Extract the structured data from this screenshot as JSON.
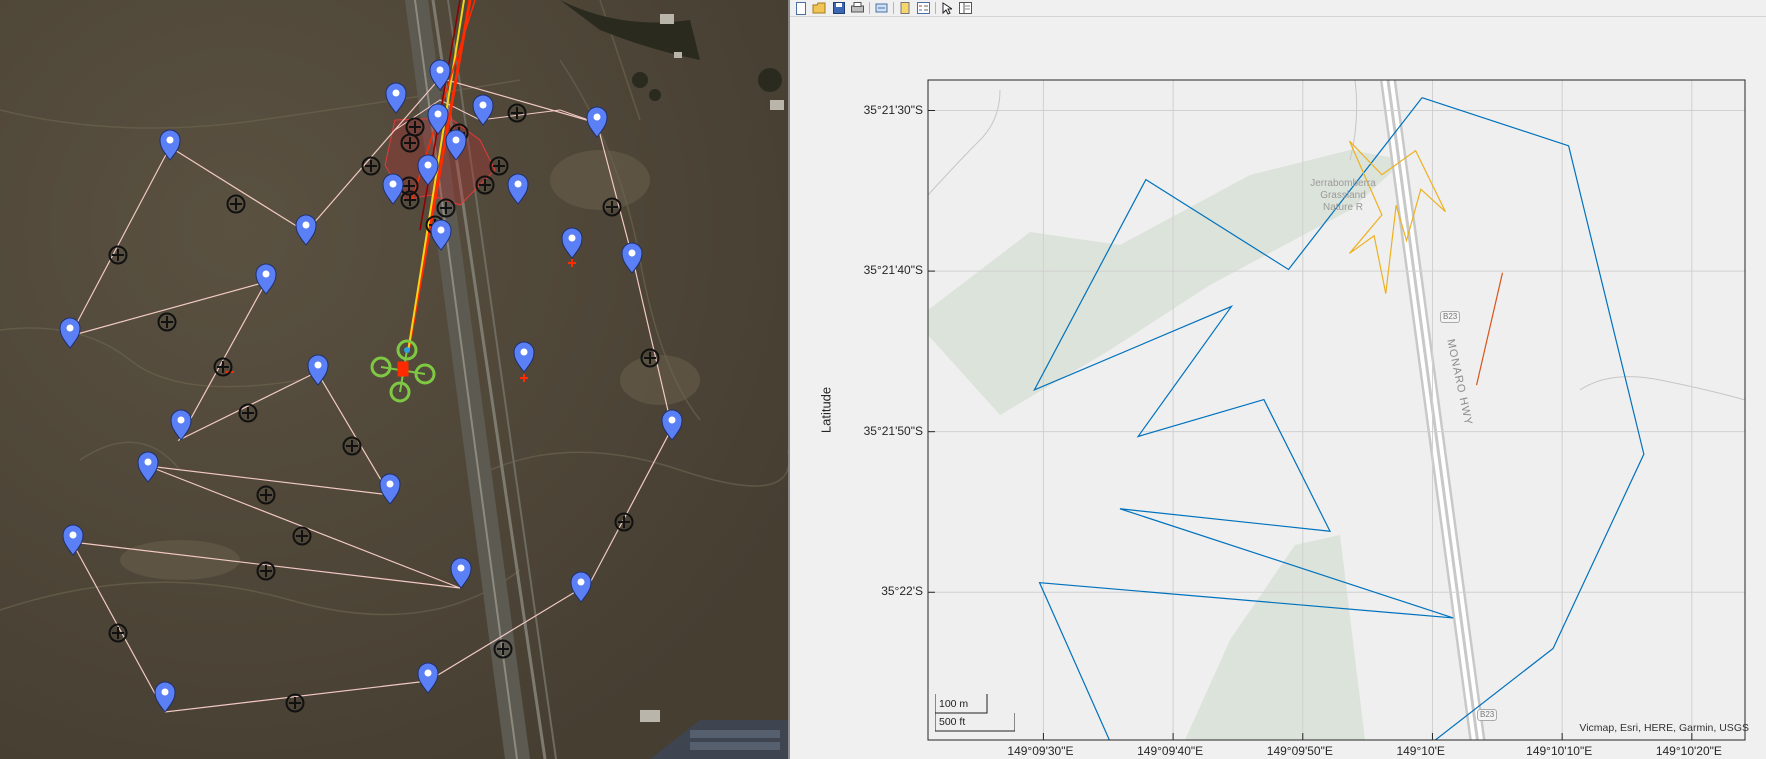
{
  "left_map": {
    "description_icons": [
      "waypoint-marker-icon",
      "waypoint-crosshair-icon",
      "quadcopter-icon"
    ],
    "colors": {
      "ground": "#4e4638",
      "path": "#f2c9c4",
      "marker": "#5b7ff5",
      "vehicle": "#7ec843",
      "track": "#ff2a00",
      "track2": "#f3d516"
    }
  },
  "toolbar": {
    "icons": [
      "new-figure-icon",
      "open-file-icon",
      "save-icon",
      "print-icon",
      "link-icon",
      "insert-colorbar-icon",
      "insert-legend-icon",
      "pointer-icon",
      "property-inspector-icon"
    ]
  },
  "chart_data": {
    "type": "line",
    "title": "",
    "xlabel": "",
    "ylabel": "Latitude",
    "x_ticks": [
      "149°09'30\"E",
      "149°09'40\"E",
      "149°09'50\"E",
      "149°10'E",
      "149°10'10\"E",
      "149°10'20\"E"
    ],
    "y_ticks": [
      "35°21'30\"S",
      "35°21'40\"S",
      "35°21'50\"S",
      "35°22'S"
    ],
    "x_tick_values_arcsec": [
      570,
      580,
      590,
      600,
      610,
      620
    ],
    "y_tick_values_arcsec": [
      90,
      100,
      110,
      120
    ],
    "xlim_arcsec": [
      561.1,
      624.1
    ],
    "ylim_arcsec": [
      88.1,
      129.2
    ],
    "grid": true,
    "series": [
      {
        "color": "#0072bd",
        "points": [
          [
            599.2,
            89.2
          ],
          [
            610.5,
            92.2
          ],
          [
            616.3,
            111.4
          ],
          [
            609.3,
            123.5
          ],
          [
            596.4,
            131.6
          ],
          [
            576.9,
            132.5
          ],
          [
            569.7,
            119.4
          ],
          [
            601.6,
            121.6
          ],
          [
            575.9,
            114.8
          ],
          [
            592.1,
            116.2
          ],
          [
            587.0,
            108.0
          ],
          [
            577.3,
            110.3
          ],
          [
            584.5,
            102.2
          ],
          [
            569.3,
            107.4
          ],
          [
            577.9,
            94.3
          ],
          [
            588.9,
            99.9
          ],
          [
            599.2,
            89.2
          ]
        ]
      },
      {
        "color": "#edb120",
        "points": [
          [
            593.6,
            91.9
          ],
          [
            596.1,
            94.0
          ],
          [
            598.7,
            92.5
          ],
          [
            601.0,
            96.3
          ],
          [
            599.1,
            94.9
          ],
          [
            598.0,
            98.1
          ],
          [
            597.2,
            95.9
          ],
          [
            596.4,
            101.4
          ],
          [
            595.5,
            97.8
          ],
          [
            593.6,
            98.9
          ],
          [
            596.1,
            96.5
          ],
          [
            593.6,
            91.9
          ]
        ]
      },
      {
        "color": "#d95319",
        "points": [
          [
            605.4,
            100.1
          ],
          [
            603.4,
            107.1
          ]
        ]
      }
    ]
  },
  "map_labels": {
    "reserve_name_lines": [
      "Jerrabomberra",
      "Grassland",
      "Nature R"
    ],
    "highway_name": "MONARO HWY",
    "highway_shield_top": "B23",
    "highway_shield_bottom": "B23",
    "attribution": "Vicmap, Esri, HERE, Garmin, USGS",
    "scale_metric": "100 m",
    "scale_imperial": "500 ft"
  }
}
